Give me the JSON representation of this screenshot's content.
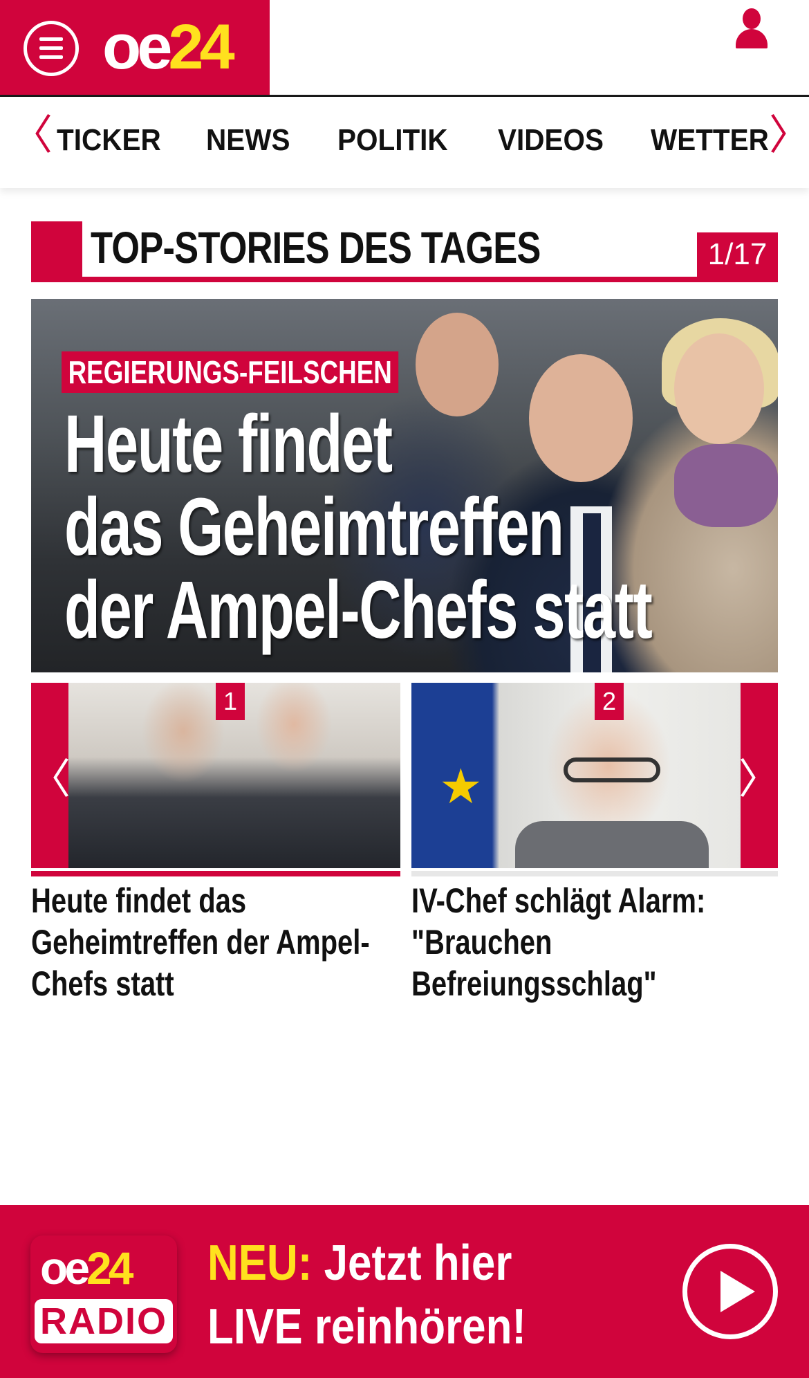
{
  "header": {
    "logo_oe": "oe",
    "logo_24": "24",
    "brand_color": "#d0043c",
    "accent_color": "#ffe11e"
  },
  "nav": {
    "prev_arrow": "〈",
    "next_arrow": "〉",
    "items": [
      {
        "label": "TICKER"
      },
      {
        "label": "NEWS"
      },
      {
        "label": "POLITIK"
      },
      {
        "label": "VIDEOS"
      },
      {
        "label": "WETTER"
      }
    ]
  },
  "section": {
    "title": "TOP-STORIES DES TAGES",
    "counter": "1/17"
  },
  "hero": {
    "tag": "REGIERUNGS-FEILSCHEN",
    "headline_lines": [
      "Heute findet",
      "das Geheimtreffen",
      "der Ampel-Chefs statt"
    ]
  },
  "carousel": {
    "prev": "〈",
    "next": "〉",
    "cards": [
      {
        "number": "1",
        "title": "Heute findet das Geheimtreffen der Ampel-Chefs statt",
        "active": true
      },
      {
        "number": "2",
        "title": "IV-Chef schlägt Alarm: \"Brauchen Befreiungsschlag\"",
        "active": false
      }
    ]
  },
  "radio": {
    "logo_oe": "oe",
    "logo_24": "24",
    "logo_label": "RADIO",
    "neu": "NEU:",
    "line1": "Jetzt hier",
    "line2": "LIVE reinhören!"
  }
}
